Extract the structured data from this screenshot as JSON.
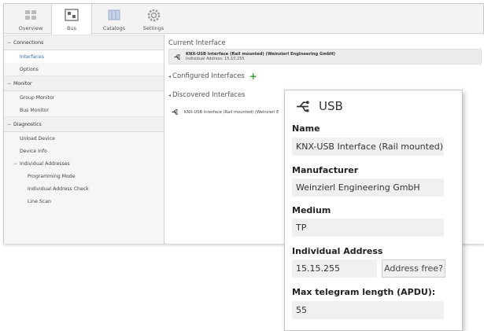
{
  "ribbon": {
    "tabs": [
      {
        "label": "Overview",
        "icon": "overview-icon"
      },
      {
        "label": "Bus",
        "icon": "bus-icon"
      },
      {
        "label": "Catalogs",
        "icon": "catalogs-icon"
      },
      {
        "label": "Settings",
        "icon": "settings-icon"
      }
    ],
    "active_tab": "Bus"
  },
  "sidebar": {
    "connections": {
      "title": "Connections",
      "items": [
        "Interfaces",
        "Options"
      ]
    },
    "monitor": {
      "title": "Monitor",
      "items": [
        "Group Monitor",
        "Bus Monitor"
      ]
    },
    "diagnostics": {
      "title": "Diagnostics",
      "items": [
        "Unload Device",
        "Device Info"
      ],
      "individual_addresses": {
        "title": "Individual Addresses",
        "items": [
          "Programming Mode",
          "Individual Address Check",
          "Line Scan"
        ]
      }
    },
    "selected": "Interfaces"
  },
  "main": {
    "current_heading": "Current Interface",
    "current_name": "KNX-USB Interface (Rail mounted) (Weinzierl Engineering GmbH)",
    "current_address": "Individual Address: 15.15.255",
    "configured_heading": "Configured Interfaces",
    "discovered_heading": "Discovered Interfaces",
    "discovered_item": "KNX-USB Interface (Rail mounted) (Weinzierl E"
  },
  "popup": {
    "title": "USB",
    "name_label": "Name",
    "name_value": "KNX-USB Interface (Rail mounted)",
    "manufacturer_label": "Manufacturer",
    "manufacturer_value": "Weinzierl Engineering GmbH",
    "medium_label": "Medium",
    "medium_value": "TP",
    "address_label": "Individual Address",
    "address_value": "15.15.255",
    "address_button": "Address free?",
    "apdu_label": "Max telegram length (APDU):",
    "apdu_value": "55"
  },
  "colors": {
    "selected_text": "#2b6cb0",
    "add_icon": "#3aa23a"
  }
}
